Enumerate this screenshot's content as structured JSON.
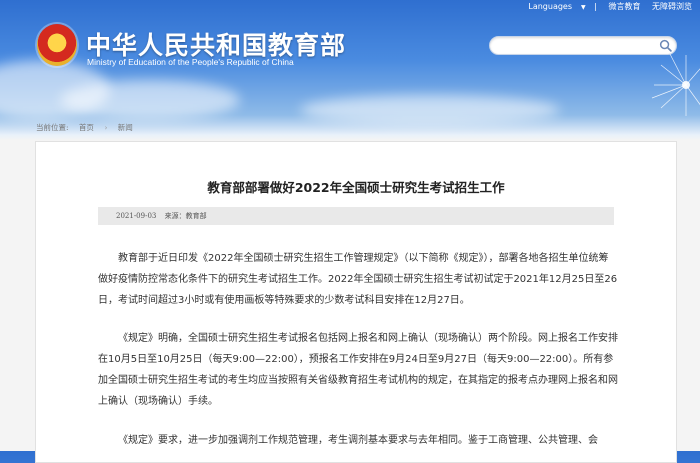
{
  "header": {
    "title": "中华人民共和国教育部",
    "subtitle": "Ministry of Education of the People's Republic of China",
    "links": {
      "languages": "Languages",
      "weibo": "微言教育",
      "accessibility": "无障碍浏览"
    },
    "search": {
      "placeholder": ""
    }
  },
  "breadcrumb": {
    "prefix": "当前位置:",
    "home": "首页",
    "current": "新闻"
  },
  "article": {
    "title": "教育部部署做好2022年全国硕士研究生考试招生工作",
    "date": "2021-09-03",
    "source": "来源：教育部",
    "paragraphs": [
      "教育部于近日印发《2022年全国硕士研究生招生工作管理规定》（以下简称《规定》），部署各地各招生单位统筹做好疫情防控常态化条件下的研究生考试招生工作。2022年全国硕士研究生招生考试初试定于2021年12月25日至26日，考试时间超过3小时或有使用画板等特殊要求的少数考试科目安排在12月27日。",
      "《规定》明确，全国硕士研究生招生考试报名包括网上报名和网上确认（现场确认）两个阶段。网上报名工作安排在10月5日至10月25日（每天9:00—22:00），预报名工作安排在9月24日至9月27日（每天9:00—22:00）。所有参加全国硕士研究生招生考试的考生均应当按照有关省级教育招生考试机构的规定，在其指定的报考点办理网上报名和网上确认（现场确认）手续。",
      "《规定》要求，进一步加强调剂工作规范管理，考生调剂基本要求与去年相同。鉴于工商管理、公共管理、会"
    ]
  },
  "colors": {
    "header_blue": "#2f6fd0",
    "page_bg": "#f4f4f4",
    "meta_bar": "#e9e9e9"
  },
  "icons": {
    "search": "search-icon",
    "emblem": "national-emblem",
    "dropdown": "chevron-down-icon"
  }
}
